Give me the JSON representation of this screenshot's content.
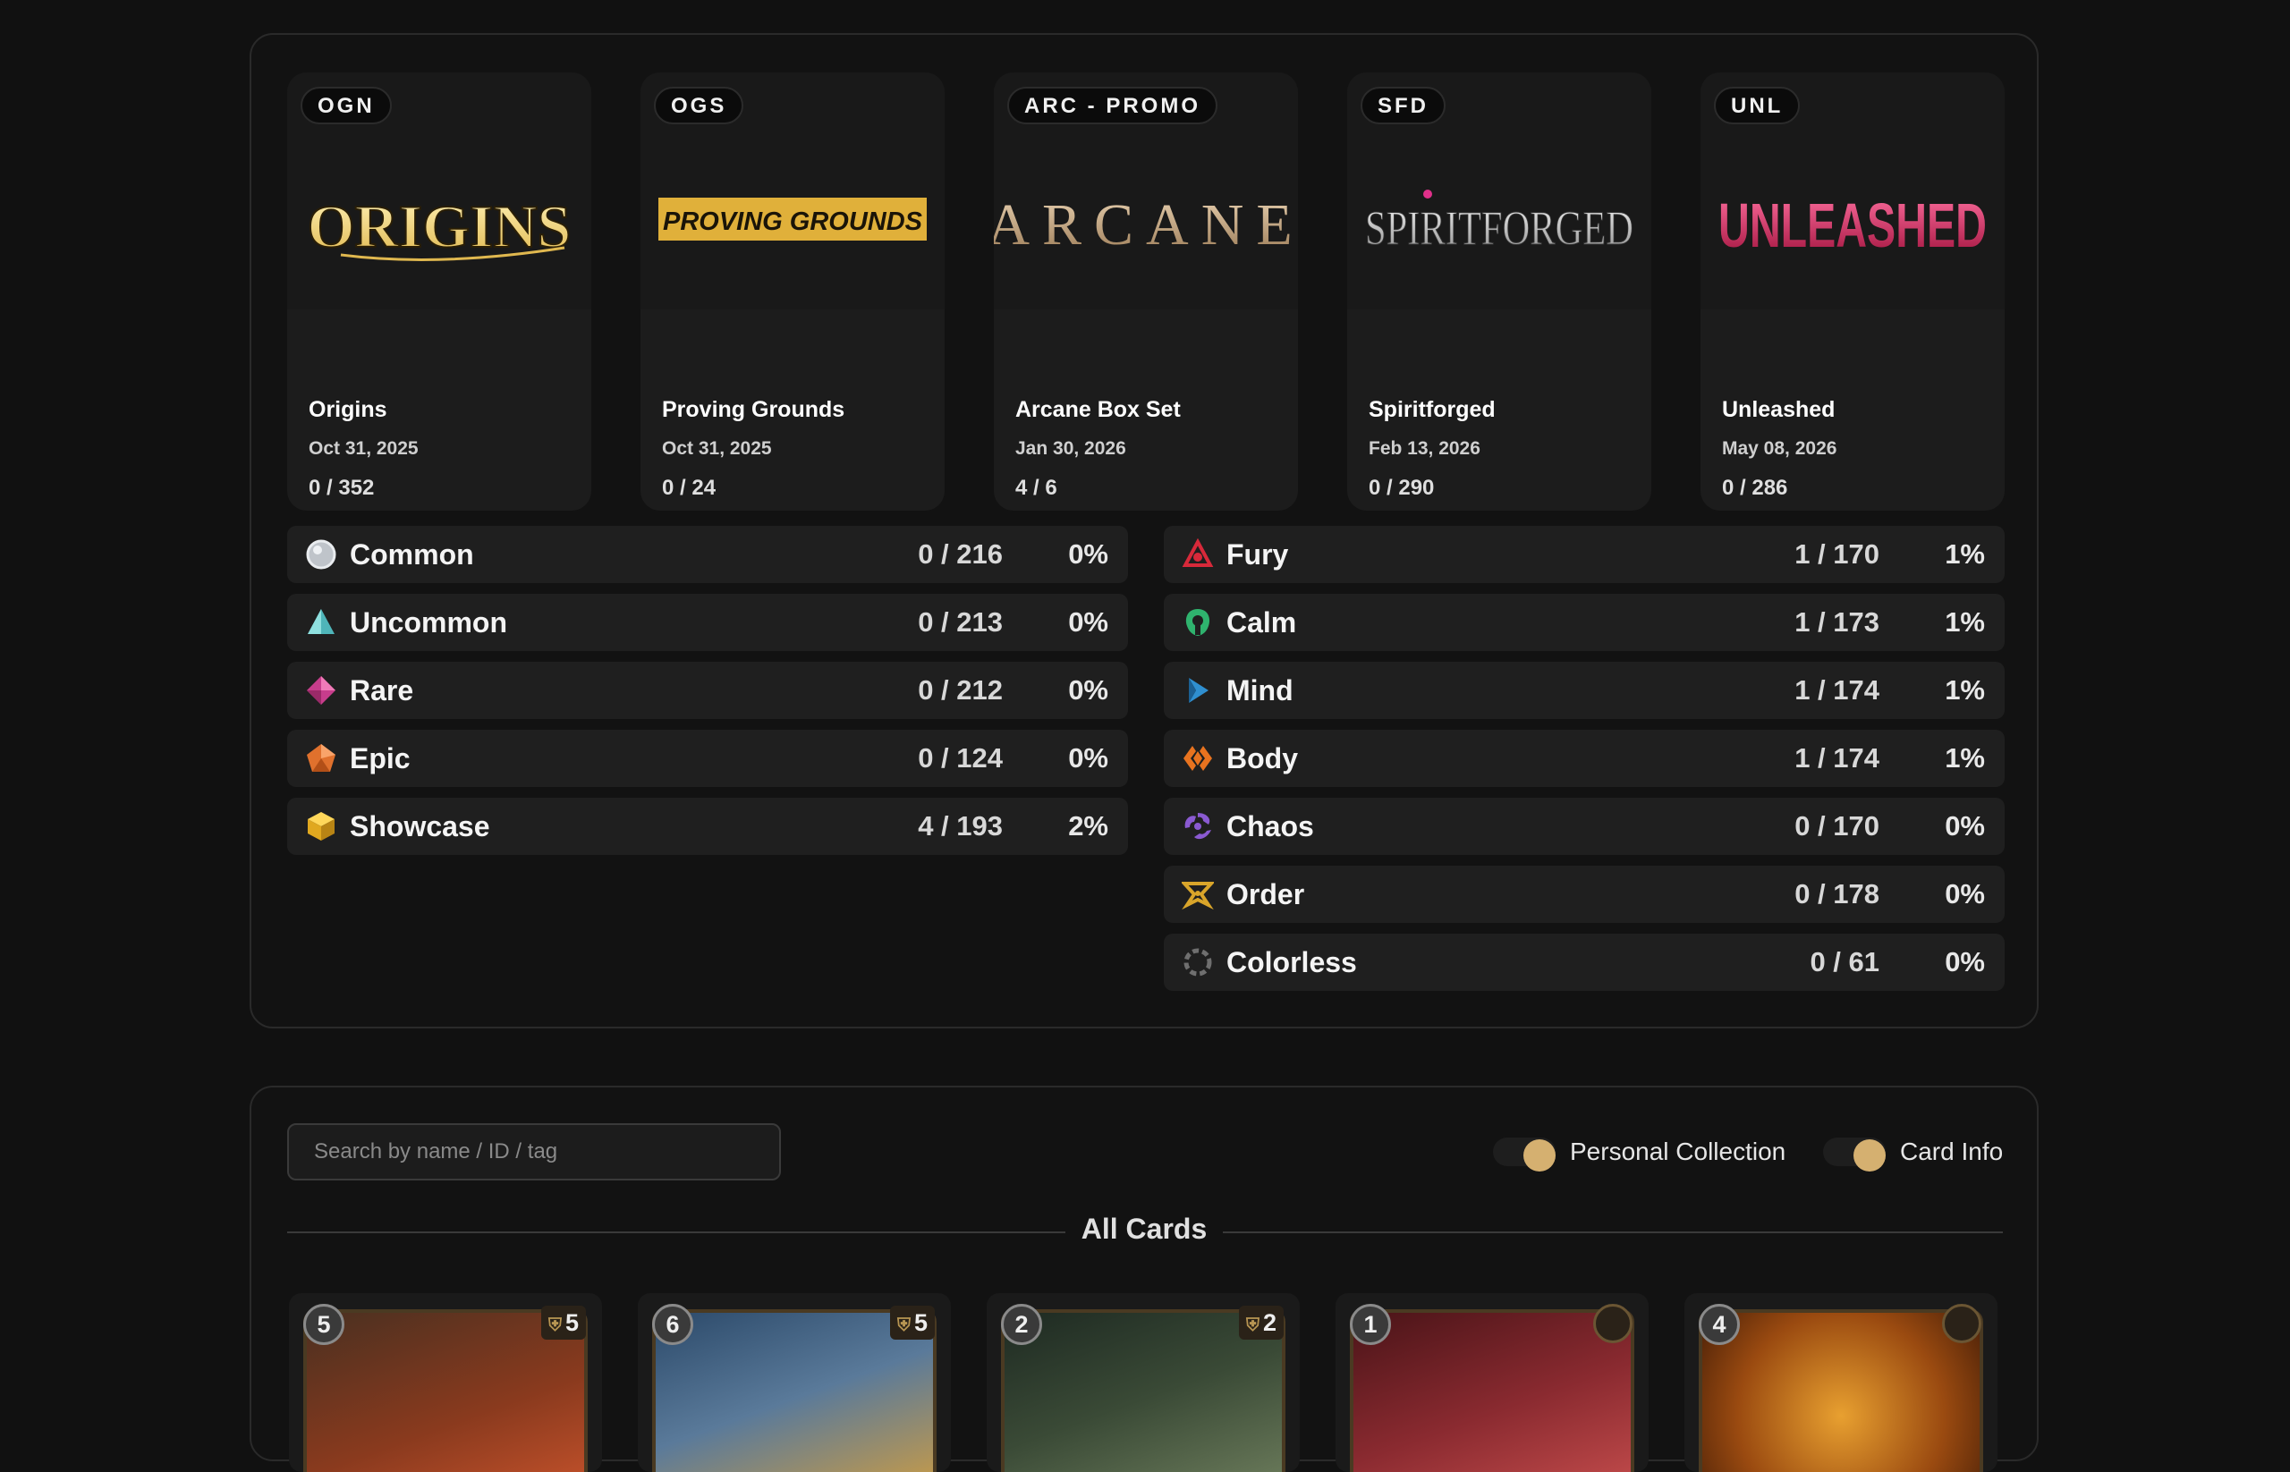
{
  "sets": [
    {
      "code": "OGN",
      "name": "Origins",
      "date": "Oct 31, 2025",
      "count": "0 / 352",
      "progress": 0,
      "logo_text": "ORIGINS"
    },
    {
      "code": "OGS",
      "name": "Proving Grounds",
      "date": "Oct 31, 2025",
      "count": "0 / 24",
      "progress": 0,
      "logo_text": "PROVING GROUNDS"
    },
    {
      "code": "ARC - PROMO",
      "name": "Arcane Box Set",
      "date": "Jan 30, 2026",
      "count": "4 / 6",
      "progress": 0.667,
      "logo_text": "ARCANE"
    },
    {
      "code": "SFD",
      "name": "Spiritforged",
      "date": "Feb 13, 2026",
      "count": "0 / 290",
      "progress": 0,
      "logo_text": "SPIRITFORGED"
    },
    {
      "code": "UNL",
      "name": "Unleashed",
      "date": "May 08, 2026",
      "count": "0 / 286",
      "progress": 0,
      "logo_text": "UNLEASHED"
    }
  ],
  "rarities": [
    {
      "label": "Common",
      "count": "0 / 216",
      "pct": "0%",
      "icon": "common-circle-icon",
      "color": "#cfd3d8"
    },
    {
      "label": "Uncommon",
      "count": "0 / 213",
      "pct": "0%",
      "icon": "uncommon-triangle-icon",
      "color": "#5fc2c2"
    },
    {
      "label": "Rare",
      "count": "0 / 212",
      "pct": "0%",
      "icon": "rare-gem-icon",
      "color": "#d94f9c"
    },
    {
      "label": "Epic",
      "count": "0 / 124",
      "pct": "0%",
      "icon": "epic-pentagon-icon",
      "color": "#e0712d"
    },
    {
      "label": "Showcase",
      "count": "4 / 193",
      "pct": "2%",
      "icon": "showcase-cube-icon",
      "color": "#e8b92a"
    }
  ],
  "domains": [
    {
      "label": "Fury",
      "count": "1 / 170",
      "pct": "1%",
      "icon": "fury-icon",
      "color": "#d8293a"
    },
    {
      "label": "Calm",
      "count": "1 / 173",
      "pct": "1%",
      "icon": "calm-icon",
      "color": "#2fb36e"
    },
    {
      "label": "Mind",
      "count": "1 / 174",
      "pct": "1%",
      "icon": "mind-icon",
      "color": "#2f8fd0"
    },
    {
      "label": "Body",
      "count": "1 / 174",
      "pct": "1%",
      "icon": "body-icon",
      "color": "#e8731f"
    },
    {
      "label": "Chaos",
      "count": "0 / 170",
      "pct": "0%",
      "icon": "chaos-icon",
      "color": "#8a5ad1"
    },
    {
      "label": "Order",
      "count": "0 / 178",
      "pct": "0%",
      "icon": "order-icon",
      "color": "#d9a52a"
    },
    {
      "label": "Colorless",
      "count": "0 / 61",
      "pct": "0%",
      "icon": "colorless-icon",
      "color": "#8a8a8a"
    }
  ],
  "search": {
    "placeholder": "Search by name / ID / tag",
    "value": ""
  },
  "toggles": {
    "personal_collection": "Personal Collection",
    "card_info": "Card Info"
  },
  "section_title": "All Cards",
  "cards": [
    {
      "cost": "5",
      "might": "5",
      "art": "#6a2a1a"
    },
    {
      "cost": "6",
      "might": "5",
      "art": "#3a5a7a"
    },
    {
      "cost": "2",
      "might": "2",
      "art": "#2a3a2a"
    },
    {
      "cost": "1",
      "might": "",
      "art": "#5a1a1e"
    },
    {
      "cost": "4",
      "might": "",
      "art": "#7a4a10"
    }
  ],
  "colors": {
    "accent": "#d4af6c",
    "background": "#111111",
    "row": "#1f1f1f"
  }
}
